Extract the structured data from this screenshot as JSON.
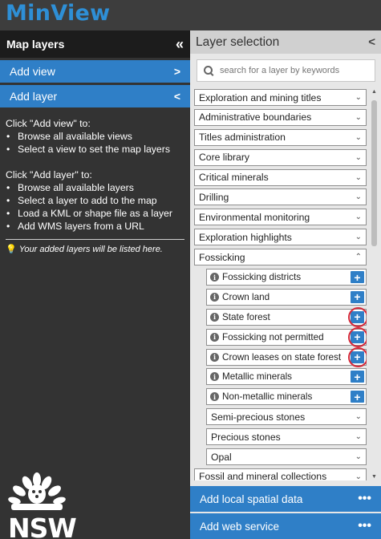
{
  "app": {
    "title": "MinView"
  },
  "left_panel": {
    "title": "Map layers",
    "collapse_glyph": "«",
    "add_view_label": "Add view",
    "add_layer_label": "Add layer",
    "help_view_intro": "Click \"Add view\" to:",
    "help_view_items": [
      "Browse all available views",
      "Select a view to set the map layers"
    ],
    "help_layer_intro": "Click \"Add layer\" to:",
    "help_layer_items": [
      "Browse all available layers",
      "Select a layer to add to the map",
      "Load a KML or shape file as a layer",
      "Add WMS layers from a URL"
    ],
    "note": "Your added layers will be listed here.",
    "brand": "NSW"
  },
  "right_panel": {
    "title": "Layer selection",
    "search_placeholder": "search for a layer by keywords",
    "categories": [
      "Exploration and mining titles",
      "Administrative boundaries",
      "Titles administration",
      "Core library",
      "Critical minerals",
      "Drilling",
      "Environmental monitoring",
      "Exploration highlights",
      "Fossicking"
    ],
    "fossicking_layers": [
      {
        "label": "Fossicking districts",
        "highlighted": false
      },
      {
        "label": "Crown land",
        "highlighted": false
      },
      {
        "label": "State forest",
        "highlighted": true
      },
      {
        "label": "Fossicking not permitted",
        "highlighted": true
      },
      {
        "label": "Crown leases on state forest",
        "highlighted": true
      },
      {
        "label": "Metallic minerals",
        "highlighted": false
      },
      {
        "label": "Non-metallic minerals",
        "highlighted": false
      }
    ],
    "fossicking_groups": [
      "Semi-precious stones",
      "Precious stones",
      "Opal"
    ],
    "next_category": "Fossil and mineral collections",
    "add_local_label": "Add local spatial data",
    "add_web_label": "Add web service"
  },
  "colors": {
    "accent": "#2f7fc7",
    "brand": "#2e8fd6",
    "highlight_ring": "#d42a3a"
  }
}
